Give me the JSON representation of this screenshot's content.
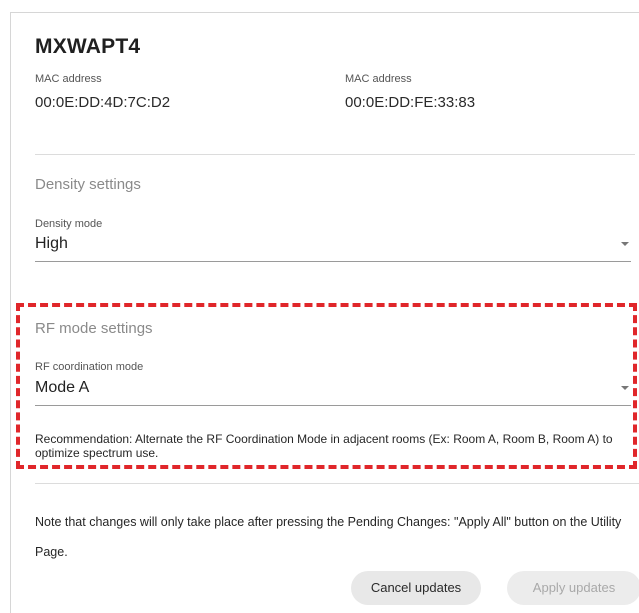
{
  "header": {
    "title": "MXWAPT4"
  },
  "mac_addresses": [
    {
      "label": "MAC address",
      "value": "00:0E:DD:4D:7C:D2"
    },
    {
      "label": "MAC address",
      "value": "00:0E:DD:FE:33:83"
    }
  ],
  "density": {
    "section_title": "Density settings",
    "field_label": "Density mode",
    "selected_value": "High"
  },
  "rf_mode": {
    "section_title": "RF mode settings",
    "field_label": "RF coordination mode",
    "selected_value": "Mode A",
    "recommendation": "Recommendation: Alternate the RF Coordination Mode in adjacent rooms (Ex: Room A, Room B, Room A) to optimize spectrum use."
  },
  "note": "Note that changes will only take place after pressing the Pending Changes: \"Apply All\" button on the Utility Page.",
  "buttons": {
    "cancel_label": "Cancel updates",
    "apply_label": "Apply updates"
  },
  "colors": {
    "highlight_border": "#e0262a",
    "divider": "#dcdcdc",
    "disabled_text": "#a9a9a9"
  },
  "icons": {
    "dropdown": "caret-down-icon"
  }
}
